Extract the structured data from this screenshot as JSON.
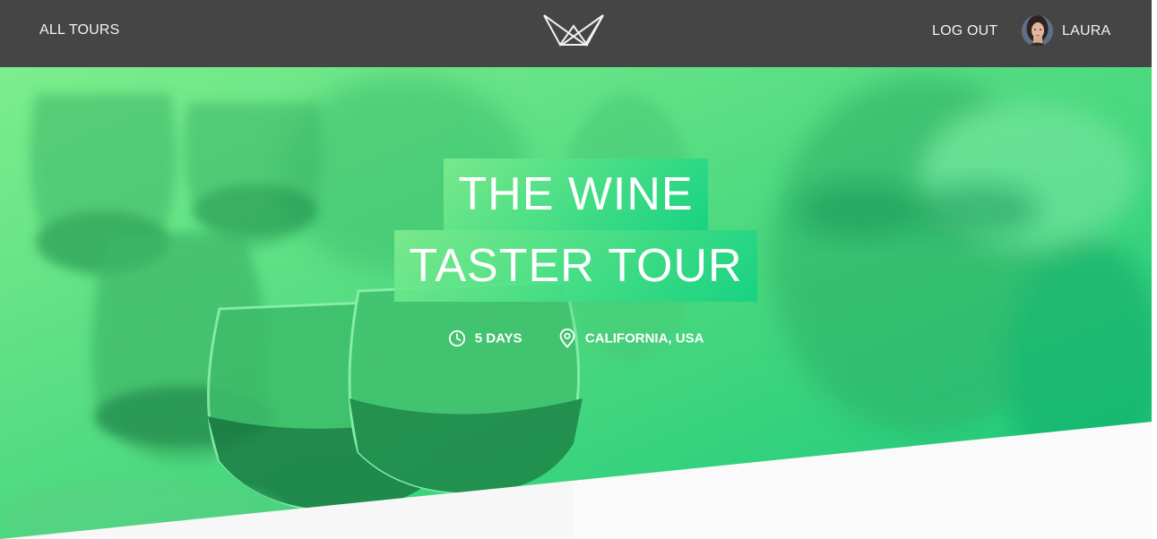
{
  "nav": {
    "all_tours_label": "ALL TOURS",
    "logout_label": "LOG OUT",
    "user_name": "LAURA",
    "logo_icon": "crown-logo-icon",
    "avatar_icon": "user-avatar"
  },
  "hero": {
    "title_line_1": "THE WINE",
    "title_line_2": "TASTER TOUR",
    "duration_icon": "clock-icon",
    "duration": "5 DAYS",
    "location_icon": "map-pin-icon",
    "location": "CALIFORNIA, USA"
  },
  "colors": {
    "nav_background": "#454545",
    "nav_text": "#f2f2f2",
    "hero_gradient_start": "#7ded8c",
    "hero_gradient_end": "#14cf82",
    "hero_text": "#ffffff",
    "lower_left_panel": "#f7f7f7",
    "lower_right_panel": "#fafafa"
  }
}
